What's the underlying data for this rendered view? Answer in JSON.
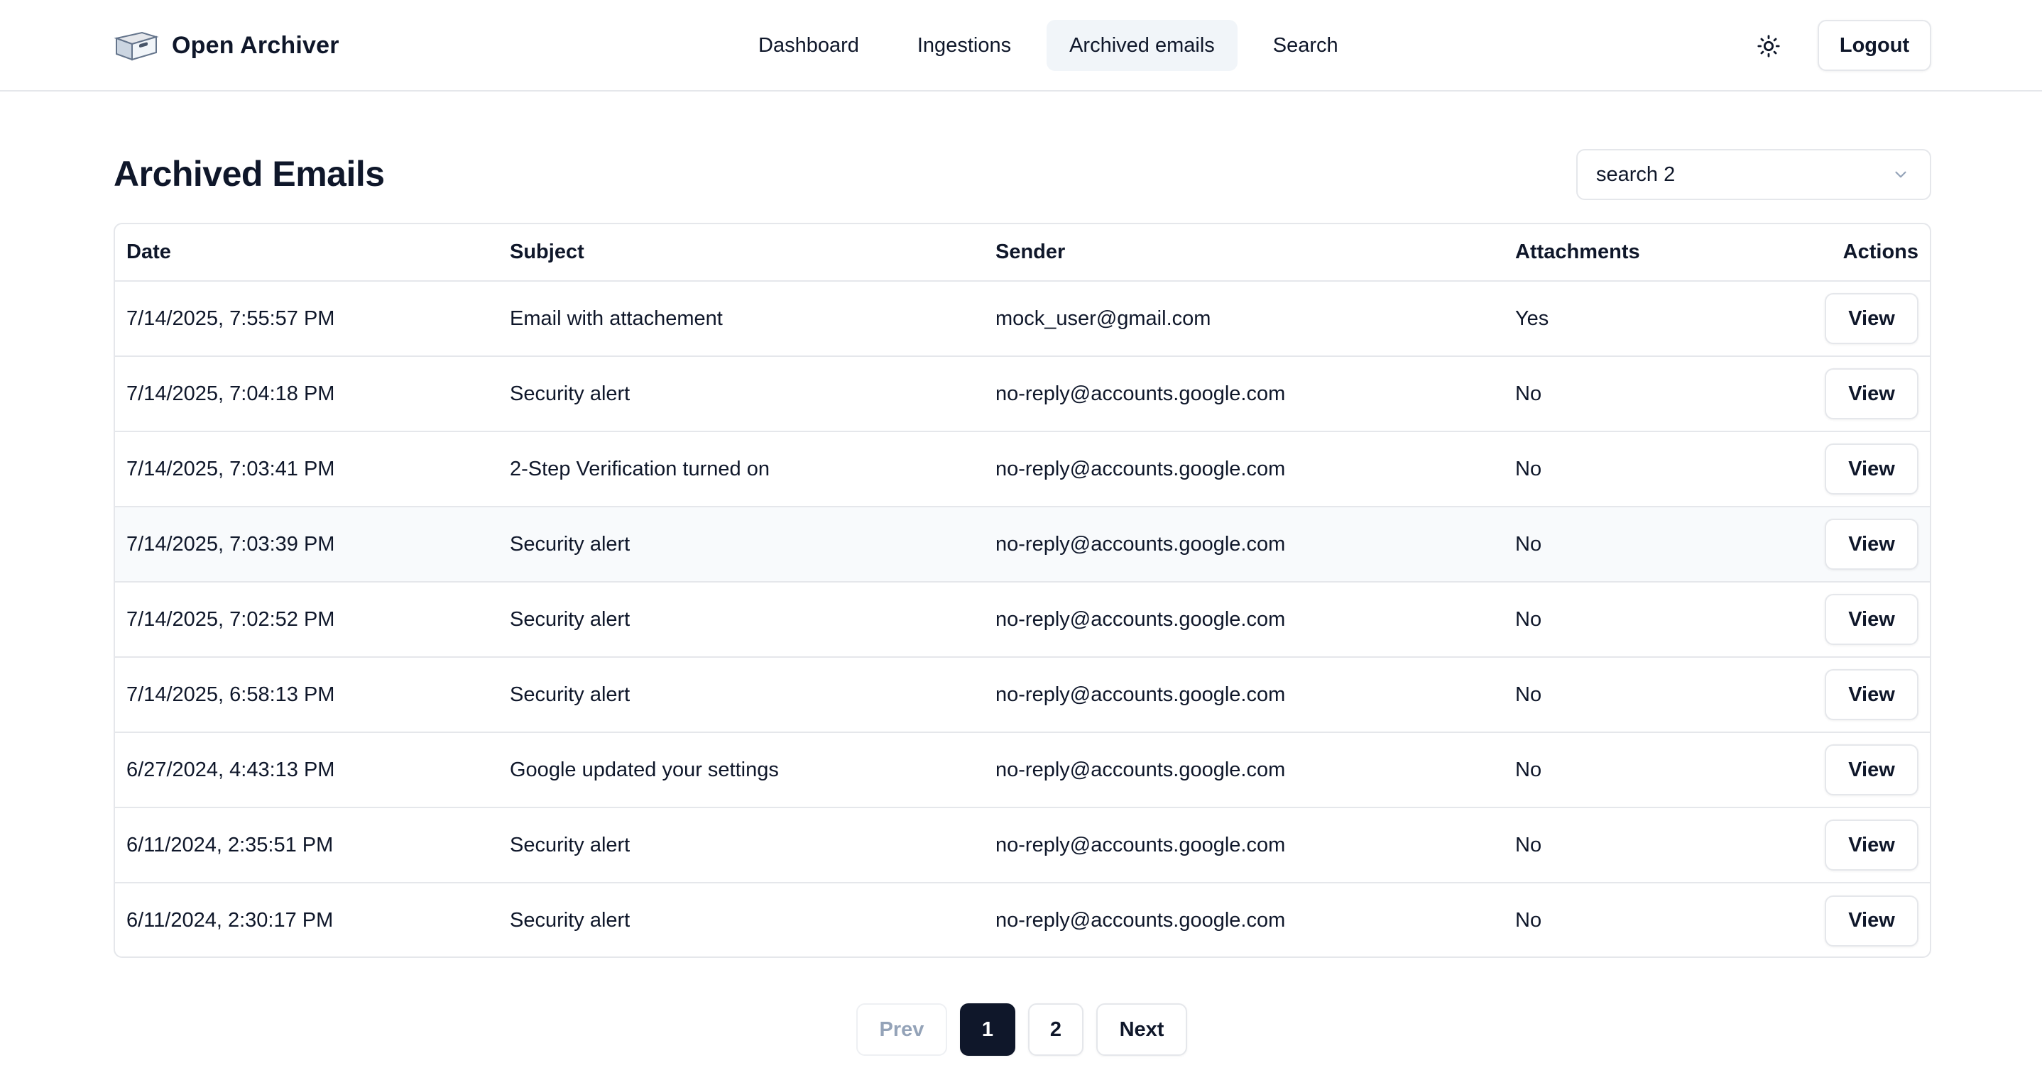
{
  "app": {
    "name": "Open Archiver"
  },
  "nav": {
    "items": [
      {
        "label": "Dashboard",
        "active": false
      },
      {
        "label": "Ingestions",
        "active": false
      },
      {
        "label": "Archived emails",
        "active": true
      },
      {
        "label": "Search",
        "active": false
      }
    ],
    "theme_icon": "sun-icon",
    "logout_label": "Logout"
  },
  "page": {
    "title": "Archived Emails",
    "source_select": {
      "value": "search 2",
      "icon": "chevron-down-icon"
    }
  },
  "table": {
    "columns": [
      "Date",
      "Subject",
      "Sender",
      "Attachments",
      "Actions"
    ],
    "rows": [
      {
        "date": "7/14/2025, 7:55:57 PM",
        "subject": "Email with attachement",
        "sender": "mock_user@gmail.com",
        "attachments": "Yes",
        "action": "View"
      },
      {
        "date": "7/14/2025, 7:04:18 PM",
        "subject": "Security alert",
        "sender": "no-reply@accounts.google.com",
        "attachments": "No",
        "action": "View"
      },
      {
        "date": "7/14/2025, 7:03:41 PM",
        "subject": "2-Step Verification turned on",
        "sender": "no-reply@accounts.google.com",
        "attachments": "No",
        "action": "View"
      },
      {
        "date": "7/14/2025, 7:03:39 PM",
        "subject": "Security alert",
        "sender": "no-reply@accounts.google.com",
        "attachments": "No",
        "action": "View"
      },
      {
        "date": "7/14/2025, 7:02:52 PM",
        "subject": "Security alert",
        "sender": "no-reply@accounts.google.com",
        "attachments": "No",
        "action": "View"
      },
      {
        "date": "7/14/2025, 6:58:13 PM",
        "subject": "Security alert",
        "sender": "no-reply@accounts.google.com",
        "attachments": "No",
        "action": "View"
      },
      {
        "date": "6/27/2024, 4:43:13 PM",
        "subject": "Google updated your settings",
        "sender": "no-reply@accounts.google.com",
        "attachments": "No",
        "action": "View"
      },
      {
        "date": "6/11/2024, 2:35:51 PM",
        "subject": "Security alert",
        "sender": "no-reply@accounts.google.com",
        "attachments": "No",
        "action": "View"
      },
      {
        "date": "6/11/2024, 2:30:17 PM",
        "subject": "Security alert",
        "sender": "no-reply@accounts.google.com",
        "attachments": "No",
        "action": "View"
      }
    ]
  },
  "pagination": {
    "prev_label": "Prev",
    "pages": [
      "1",
      "2"
    ],
    "current_page": "1",
    "next_label": "Next"
  },
  "colors": {
    "text": "#0f172a",
    "border": "#e5e7eb",
    "active_nav_bg": "#f1f5f9",
    "active_page_bg": "#0f172a",
    "disabled_text": "#94a3b8",
    "row_hover_bg": "#f8fafc"
  }
}
